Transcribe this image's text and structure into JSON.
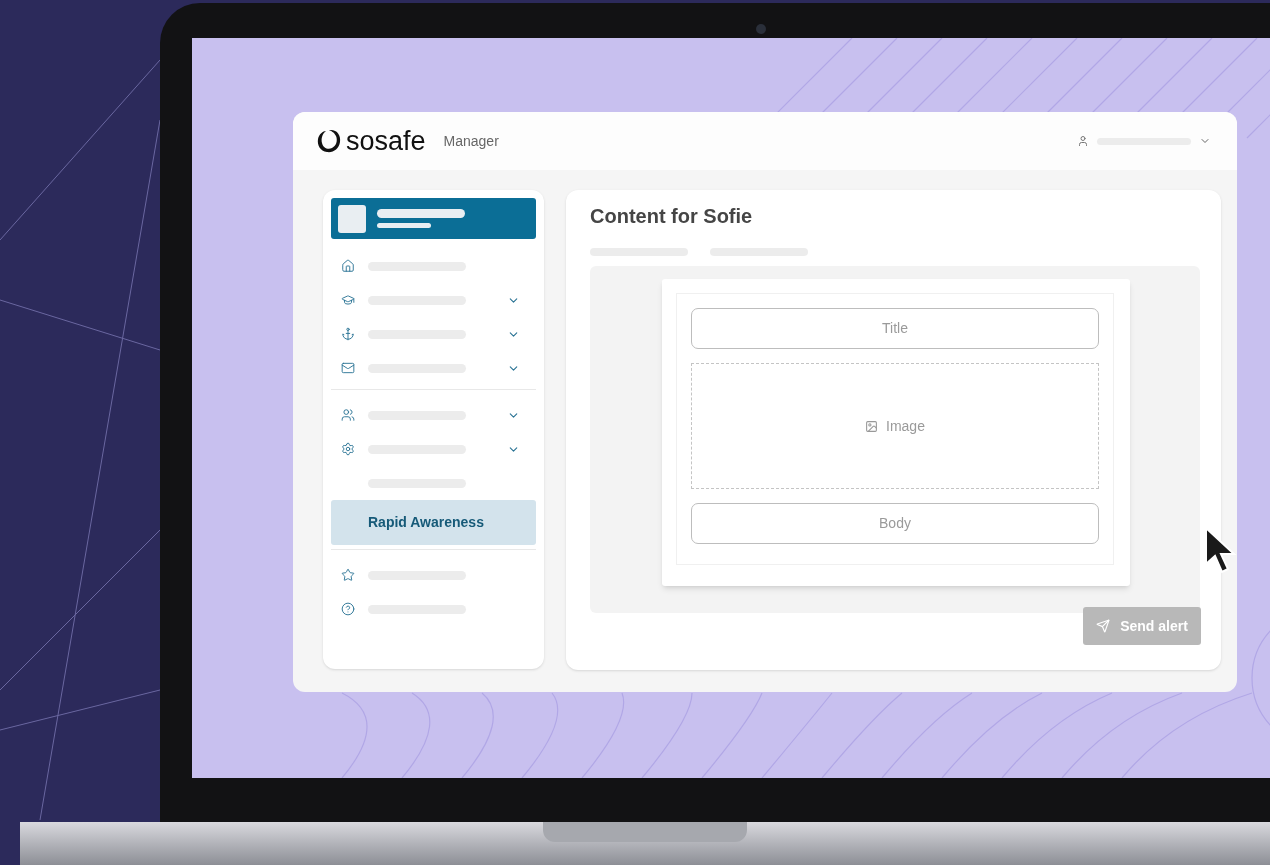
{
  "header": {
    "logo": "sosafe",
    "product": "Manager"
  },
  "sidebar": {
    "groups": [
      [
        {
          "kind": "nav",
          "expandable": false,
          "selected": false
        },
        {
          "kind": "nav",
          "expandable": true,
          "selected": false
        },
        {
          "kind": "nav",
          "expandable": true,
          "selected": false
        },
        {
          "kind": "nav",
          "expandable": true,
          "selected": false
        }
      ],
      [
        {
          "kind": "nav",
          "expandable": true,
          "selected": false
        },
        {
          "kind": "nav",
          "expandable": true,
          "selected": false
        },
        {
          "kind": "sub",
          "expandable": false,
          "selected": false
        },
        {
          "label": "Rapid Awareness",
          "selected": true
        }
      ],
      [
        {
          "kind": "nav",
          "expandable": false,
          "selected": false
        },
        {
          "kind": "nav",
          "expandable": false,
          "selected": false
        }
      ]
    ]
  },
  "content": {
    "title": "Content for Sofie",
    "form": {
      "title_placeholder": "Title",
      "image_label": "Image",
      "body_placeholder": "Body"
    },
    "send_button": {
      "label": "Send alert",
      "disabled": true
    }
  }
}
